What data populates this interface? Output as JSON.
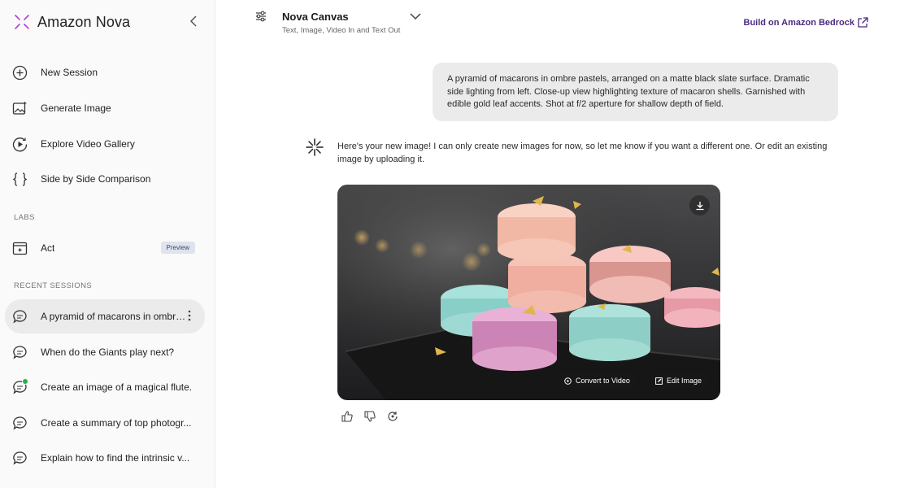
{
  "brand": {
    "name": "Amazon Nova",
    "logo_icon": "nova-star-logo",
    "accent": "#b23dbf"
  },
  "sidebar": {
    "collapse_icon": "chevron-left-icon",
    "items": [
      {
        "label": "New Session",
        "icon": "plus-circle-icon"
      },
      {
        "label": "Generate Image",
        "icon": "image-sparkle-icon"
      },
      {
        "label": "Explore Video Gallery",
        "icon": "play-circle-icon"
      },
      {
        "label": "Side by Side Comparison",
        "icon": "curly-braces-icon"
      }
    ],
    "labs_label": "LABS",
    "labs_items": [
      {
        "label": "Act",
        "badge": "Preview",
        "icon": "browser-window-icon"
      }
    ],
    "recent_label": "RECENT SESSIONS",
    "recent": [
      {
        "label": "A pyramid of macarons in ombre p...",
        "icon": "chat-bubble-icon",
        "active": true
      },
      {
        "label": "When do the Giants play next?",
        "icon": "chat-bubble-icon"
      },
      {
        "label": "Create an image of a magical flute.",
        "icon": "chat-bubble-icon",
        "notification": true
      },
      {
        "label": "Create a summary of top photogr...",
        "icon": "chat-bubble-icon"
      },
      {
        "label": "Explain how to find the intrinsic v...",
        "icon": "chat-bubble-icon"
      }
    ]
  },
  "header": {
    "settings_icon": "sliders-icon",
    "model_name": "Nova Canvas",
    "model_subtitle": "Text, Image, Video In and Text Out",
    "dropdown_icon": "chevron-down-icon",
    "bedrock_link": "Build on Amazon Bedrock",
    "bedrock_color": "#4b2a7e"
  },
  "chat": {
    "user_message": "A pyramid of macarons in ombre pastels, arranged on a matte black slate surface. Dramatic side lighting from left. Close-up view highlighting texture of macaron shells. Garnished with edible gold leaf accents. Shot at f/2 aperture for shallow depth of field.",
    "assistant_message": "Here's your new image! I can only create new images for now, so let me know if you want a different one. Or edit an existing image by uploading it.",
    "image_actions": {
      "convert": "Convert to Video",
      "edit": "Edit Image"
    },
    "feedback_icons": [
      "thumbs-up-icon",
      "thumbs-down-icon",
      "regenerate-icon"
    ]
  }
}
